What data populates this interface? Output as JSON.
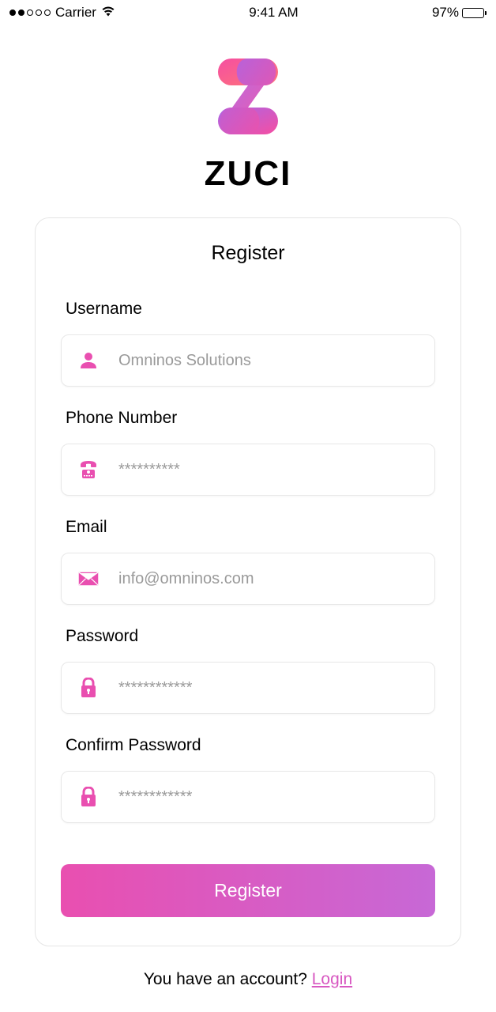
{
  "status_bar": {
    "carrier": "Carrier",
    "time": "9:41 AM",
    "battery_pct": "97%"
  },
  "logo": {
    "text": "ZUCI"
  },
  "form": {
    "title": "Register",
    "username": {
      "label": "Username",
      "placeholder": "Omninos Solutions"
    },
    "phone": {
      "label": "Phone Number",
      "placeholder": "**********"
    },
    "email": {
      "label": "Email",
      "placeholder": "info@omninos.com"
    },
    "password": {
      "label": "Password",
      "placeholder": "************"
    },
    "confirm_password": {
      "label": "Confirm Password",
      "placeholder": "************"
    },
    "submit_label": "Register"
  },
  "footer": {
    "prompt": "You have an account? ",
    "login_label": "Login"
  },
  "colors": {
    "accent": "#e94fb0",
    "accent2": "#c768d6"
  }
}
